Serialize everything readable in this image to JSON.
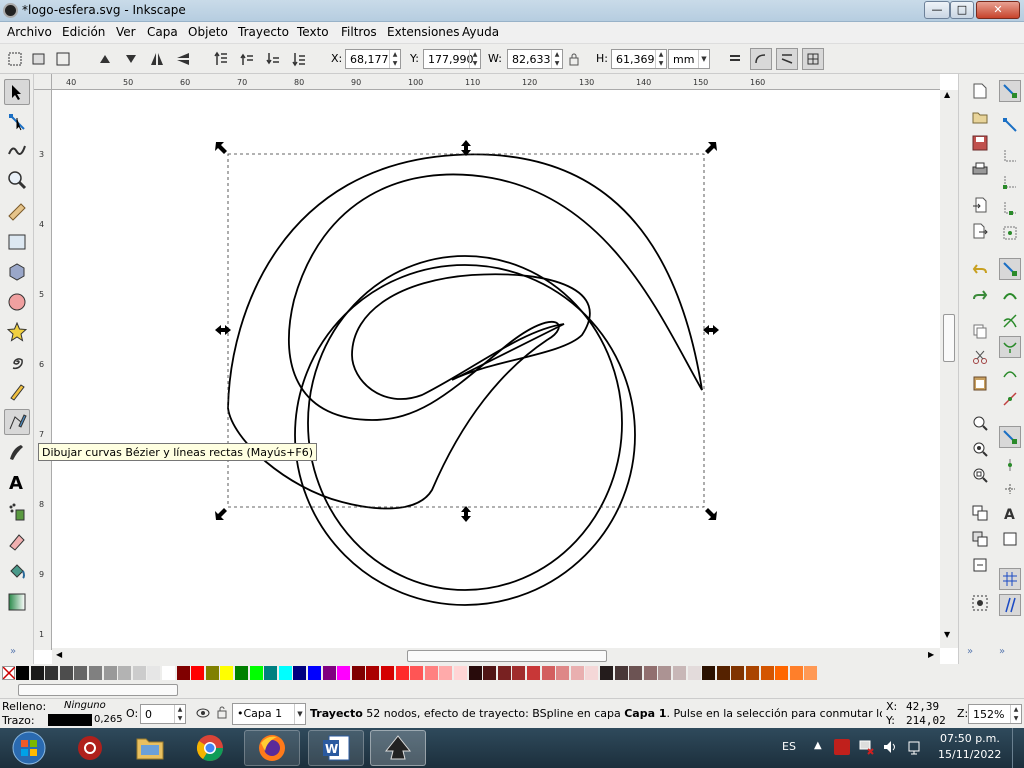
{
  "window": {
    "title": "*logo-esfera.svg - Inkscape",
    "minimize": "—",
    "maximize": "□",
    "close": "✕"
  },
  "menu": [
    "Archivo",
    "Edición",
    "Ver",
    "Capa",
    "Objeto",
    "Trayecto",
    "Texto",
    "Filtros",
    "Extensiones",
    "Ayuda"
  ],
  "toolbar": {
    "x_label": "X:",
    "x_value": "68,177",
    "y_label": "Y:",
    "y_value": "177,990",
    "w_label": "W:",
    "w_value": "82,633",
    "h_label": "H:",
    "h_value": "61,369",
    "unit": "mm"
  },
  "ruler_h": [
    "40",
    "50",
    "60",
    "70",
    "80",
    "90",
    "100",
    "110",
    "120",
    "130",
    "140",
    "150",
    "160"
  ],
  "ruler_v": [
    "3",
    "4",
    "5",
    "6",
    "7",
    "8",
    "9",
    "1"
  ],
  "tooltip": "Dibujar curvas Bézier y líneas rectas (Mayús+F6)",
  "palette": [
    "#000000",
    "#1a1a1a",
    "#333333",
    "#4d4d4d",
    "#666666",
    "#808080",
    "#999999",
    "#b3b3b3",
    "#cccccc",
    "#e6e6e6",
    "#ffffff",
    "#800000",
    "#ff0000",
    "#808000",
    "#ffff00",
    "#008000",
    "#00ff00",
    "#008080",
    "#00ffff",
    "#000080",
    "#0000ff",
    "#800080",
    "#ff00ff",
    "#800000",
    "#aa0000",
    "#d40000",
    "#ff2a2a",
    "#ff5555",
    "#ff8080",
    "#ffaaaa",
    "#ffd5d5",
    "#280b0b",
    "#501616",
    "#782121",
    "#a02c2c",
    "#c83737",
    "#d35f5f",
    "#de8787",
    "#e9afaf",
    "#f4d7d7",
    "#241c1c",
    "#483737",
    "#6c5353",
    "#916f6f",
    "#ac9393",
    "#c8b7b7",
    "#e3dbdb",
    "#2b1100",
    "#552200",
    "#803300",
    "#aa4400",
    "#d45500",
    "#ff6600",
    "#ff7f2a",
    "#ff9955"
  ],
  "status": {
    "fill_label": "Relleno:",
    "fill_value": "Ninguno",
    "stroke_label": "Trazo:",
    "stroke_width": "0,265",
    "opacity_label": "O:",
    "opacity_value": "0",
    "layer": "•Capa 1",
    "message_bold": "Trayecto",
    "message": " 52 nodos, efecto de trayecto: BSpline en capa ",
    "message_layer": "Capa 1",
    "message_tail": ". Pulse en la selección para conmutar los tira...",
    "coord_x_label": "X:",
    "coord_x": "42,39",
    "coord_y_label": "Y:",
    "coord_y": "214,02",
    "zoom_label": "Z:",
    "zoom": "152%"
  },
  "taskbar": {
    "lang": "ES",
    "time": "07:50 p.m.",
    "date": "15/11/2022"
  }
}
